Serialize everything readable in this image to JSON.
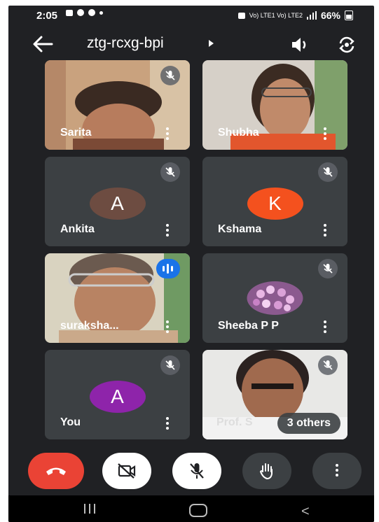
{
  "status_bar": {
    "time": "2:05",
    "signal_text": "Vo) LTE1 Vo) LTE2",
    "battery": "66%"
  },
  "header": {
    "meeting_code": "ztg-rcxg-bpi",
    "icons": [
      "back-arrow-icon",
      "speaker-icon",
      "switch-camera-icon"
    ]
  },
  "participants": [
    {
      "name": "Sarita",
      "type": "video",
      "muted": true
    },
    {
      "name": "Shubha",
      "type": "video",
      "muted": false
    },
    {
      "name": "Ankita",
      "type": "avatar",
      "initial": "A",
      "avatar_color": "#6d4c41",
      "muted": true
    },
    {
      "name": "Kshama",
      "type": "avatar",
      "initial": "K",
      "avatar_color": "#f4511e",
      "muted": true
    },
    {
      "name": "suraksha...",
      "type": "video",
      "speaking": true
    },
    {
      "name": "Sheeba P P",
      "type": "photo-avatar",
      "muted": true
    },
    {
      "name": "You",
      "type": "avatar",
      "initial": "A",
      "avatar_color": "#8e24aa",
      "muted": true
    },
    {
      "name": "Prof. S",
      "type": "video",
      "muted": true,
      "others_label": "3 others"
    }
  ],
  "controls": {
    "end_call_color": "#ea4335",
    "icons": [
      "end-call-icon",
      "camera-off-icon",
      "mic-off-icon",
      "raise-hand-icon",
      "more-options-icon"
    ]
  }
}
